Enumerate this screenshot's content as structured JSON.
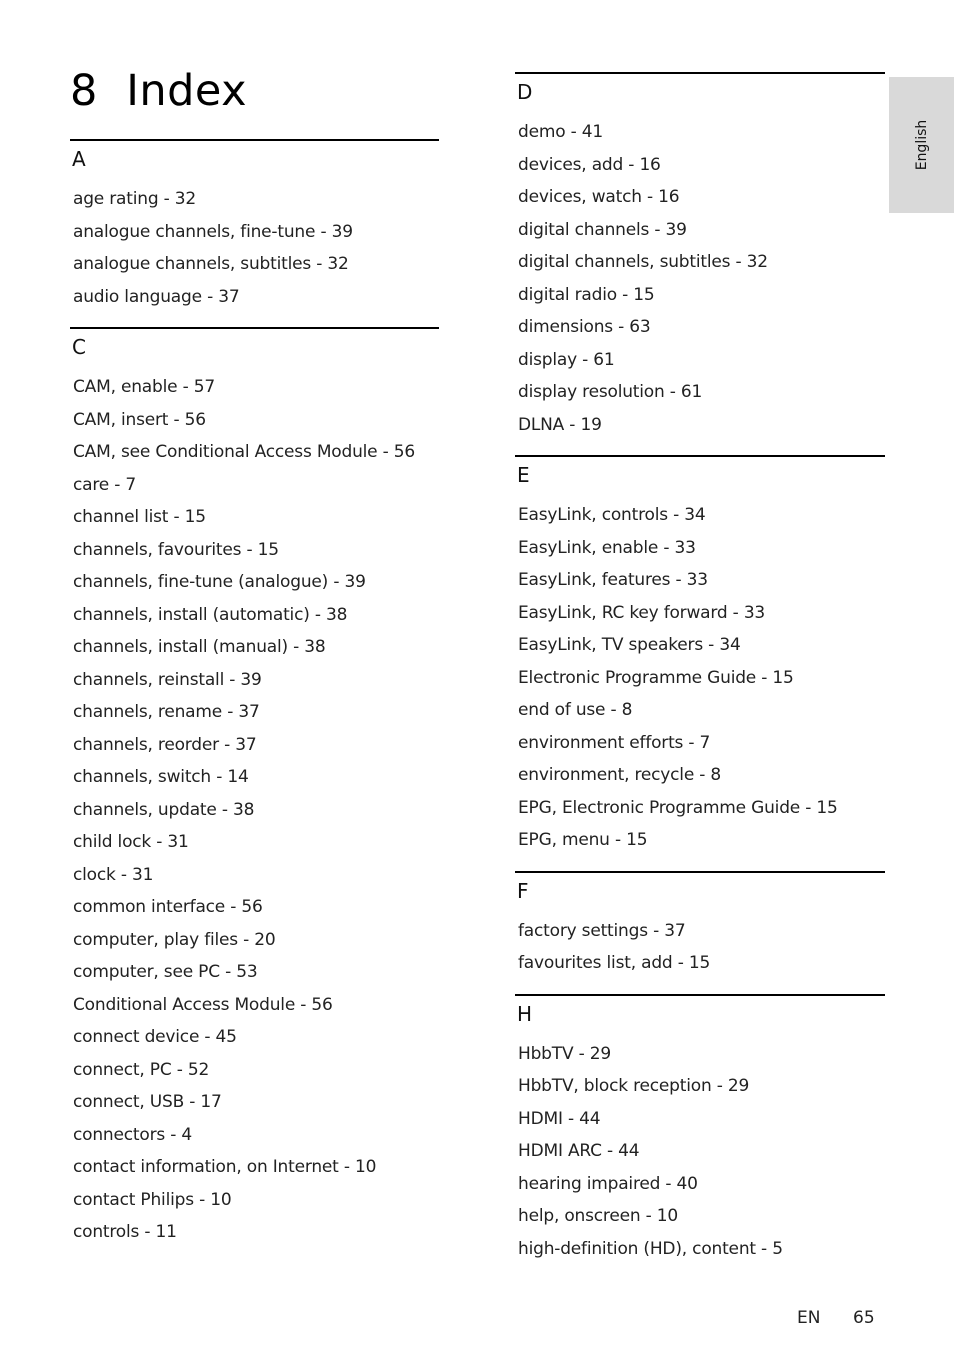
{
  "title": "8  Index",
  "language_tab": "English",
  "footer": {
    "lang": "EN",
    "page": "65"
  },
  "left_column": [
    {
      "letter": "A",
      "entries": [
        "age rating - 32",
        "analogue channels, fine-tune - 39",
        "analogue channels, subtitles - 32",
        "audio language - 37"
      ]
    },
    {
      "letter": "C",
      "entries": [
        "CAM, enable - 57",
        "CAM, insert - 56",
        "CAM, see Conditional Access Module - 56",
        "care - 7",
        "channel list - 15",
        "channels, favourites - 15",
        "channels, fine-tune (analogue) - 39",
        "channels, install (automatic) - 38",
        "channels, install (manual) - 38",
        "channels, reinstall - 39",
        "channels, rename - 37",
        "channels, reorder - 37",
        "channels, switch - 14",
        "channels, update - 38",
        "child lock - 31",
        "clock - 31",
        "common interface - 56",
        "computer, play files - 20",
        "computer, see PC - 53",
        "Conditional Access Module - 56",
        "connect device - 45",
        "connect, PC - 52",
        "connect, USB - 17",
        "connectors - 4",
        "contact information, on Internet - 10",
        "contact Philips - 10",
        "controls - 11"
      ]
    }
  ],
  "right_column": [
    {
      "letter": "D",
      "entries": [
        "demo - 41",
        "devices, add - 16",
        "devices, watch - 16",
        "digital channels - 39",
        "digital channels, subtitles - 32",
        "digital radio - 15",
        "dimensions - 63",
        "display - 61",
        "display resolution - 61",
        "DLNA - 19"
      ]
    },
    {
      "letter": "E",
      "entries": [
        "EasyLink, controls - 34",
        "EasyLink, enable - 33",
        "EasyLink, features - 33",
        "EasyLink, RC key forward - 33",
        "EasyLink, TV speakers - 34",
        "Electronic Programme Guide - 15",
        "end of use - 8",
        "environment efforts - 7",
        "environment, recycle - 8",
        "EPG, Electronic Programme Guide - 15",
        "EPG, menu - 15"
      ]
    },
    {
      "letter": "F",
      "entries": [
        "factory settings - 37",
        "favourites list, add - 15"
      ]
    },
    {
      "letter": "H",
      "entries": [
        "HbbTV - 29",
        "HbbTV, block reception - 29",
        "HDMI - 44",
        "HDMI ARC - 44",
        "hearing impaired - 40",
        "help, onscreen - 10",
        "high-definition (HD), content - 5"
      ]
    }
  ]
}
